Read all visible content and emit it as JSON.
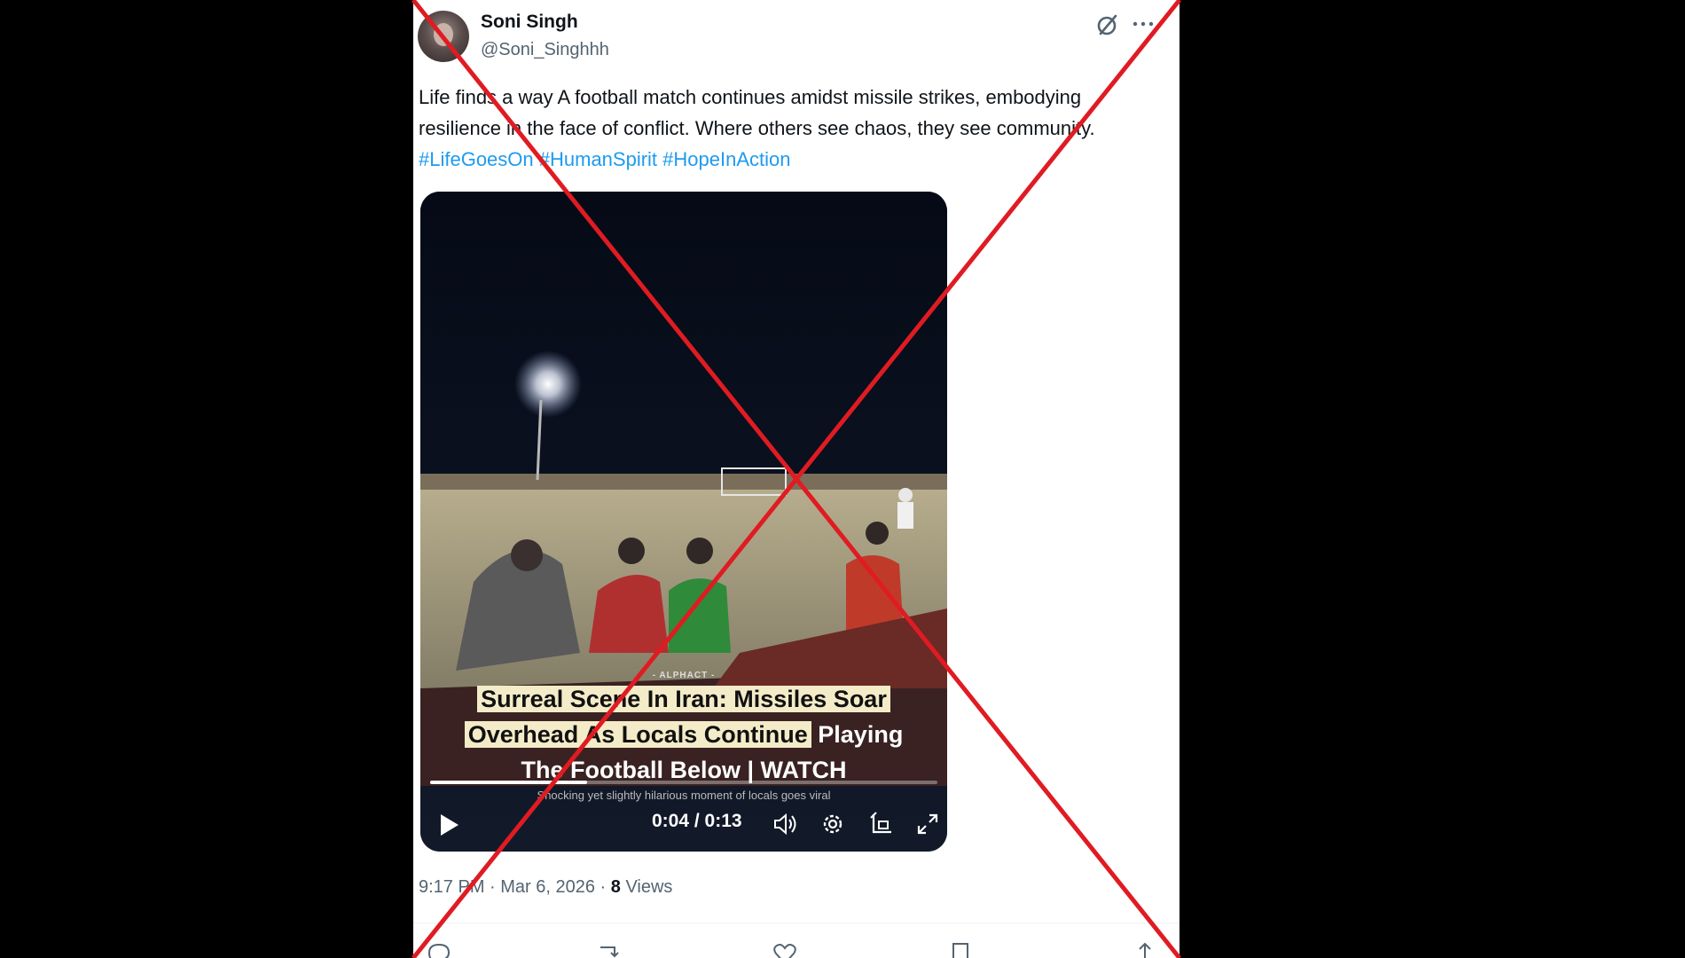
{
  "post": {
    "display_name": "Soni Singh",
    "handle": "@Soni_Singhhh",
    "text_plain": "Life finds a way  A football match continues amidst missile strikes, embodying resilience in the face of conflict. Where others see chaos, they see community. ",
    "hashtags": [
      "#LifeGoesOn",
      "#HumanSpirit",
      "#HopeInAction"
    ],
    "timestamp": "9:17 PM · Mar 6, 2026 · ",
    "views_count": "8",
    "views_label": " Views"
  },
  "video": {
    "brand": "- ALPHACT -",
    "caption_line1": "Surreal Scene In Iran: Missiles Soar",
    "caption_line2_highlight": "Overhead As Locals Continue",
    "caption_line2_rest": " Playing",
    "caption_line3": "The Football Below | WATCH",
    "caption_sub": "Shocking yet slightly hilarious moment of locals goes viral",
    "time_display": "0:04 / 0:13",
    "progress_fraction": 0.31
  },
  "icons": {
    "grok": "grok-icon",
    "more": "more-icon",
    "play": "play-icon",
    "volume": "volume-icon",
    "settings": "gear-icon",
    "pip": "picture-in-picture-icon",
    "fullscreen": "fullscreen-icon",
    "reply": "reply-icon",
    "repost": "repost-icon",
    "like": "heart-icon",
    "bookmark": "bookmark-icon",
    "share": "share-icon"
  },
  "colors": {
    "hashtag": "#1d9bf0",
    "overlay_x": "#e01b22",
    "caption_highlight": "#f4ecc8"
  }
}
